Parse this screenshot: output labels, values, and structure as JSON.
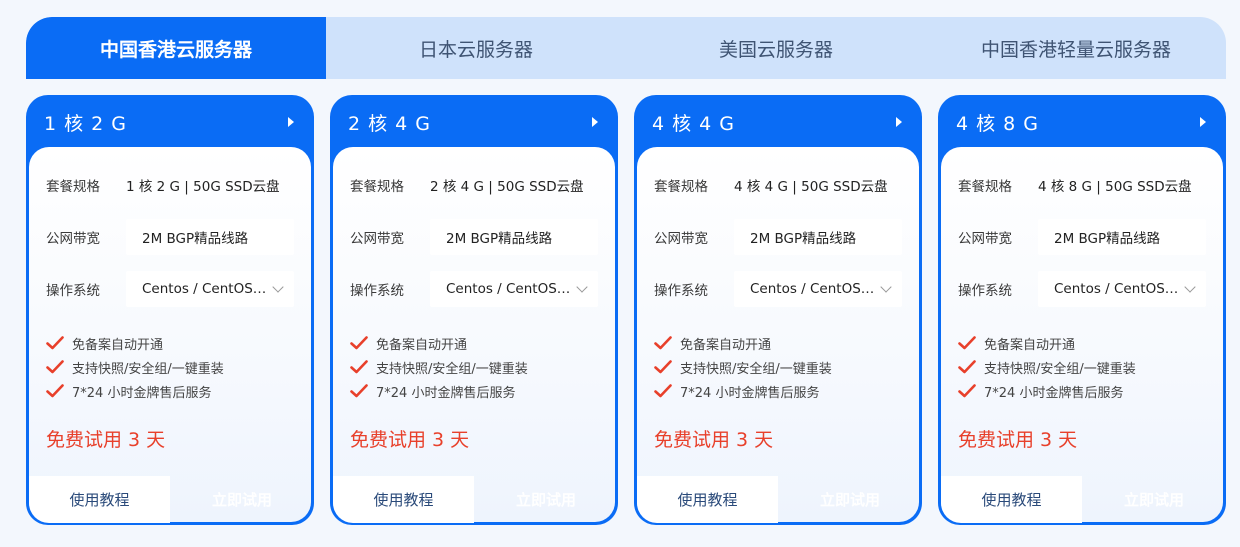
{
  "tabs": [
    {
      "label": "中国香港云服务器",
      "active": true
    },
    {
      "label": "日本云服务器",
      "active": false
    },
    {
      "label": "美国云服务器",
      "active": false
    },
    {
      "label": "中国香港轻量云服务器",
      "active": false
    }
  ],
  "labels": {
    "spec": "套餐规格",
    "bandwidth": "公网带宽",
    "os": "操作系统"
  },
  "cards": [
    {
      "title": "1 核 2 G",
      "spec": "1 核 2 G | 50G SSD云盘",
      "bandwidth": "2M BGP精品线路",
      "os": "Centos / CentOS…",
      "features": [
        "免备案自动开通",
        "支持快照/安全组/一键重装",
        "7*24 小时金牌售后服务"
      ],
      "trial": "免费试用 3 天",
      "tutorial_label": "使用教程",
      "try_label": "立即试用"
    },
    {
      "title": "2 核 4 G",
      "spec": "2 核 4 G | 50G SSD云盘",
      "bandwidth": "2M BGP精品线路",
      "os": "Centos / CentOS…",
      "features": [
        "免备案自动开通",
        "支持快照/安全组/一键重装",
        "7*24 小时金牌售后服务"
      ],
      "trial": "免费试用 3 天",
      "tutorial_label": "使用教程",
      "try_label": "立即试用"
    },
    {
      "title": "4 核 4 G",
      "spec": "4 核 4 G | 50G SSD云盘",
      "bandwidth": "2M BGP精品线路",
      "os": "Centos / CentOS…",
      "features": [
        "免备案自动开通",
        "支持快照/安全组/一键重装",
        "7*24 小时金牌售后服务"
      ],
      "trial": "免费试用 3 天",
      "tutorial_label": "使用教程",
      "try_label": "立即试用"
    },
    {
      "title": "4 核 8 G",
      "spec": "4 核 8 G | 50G SSD云盘",
      "bandwidth": "2M BGP精品线路",
      "os": "Centos / CentOS…",
      "features": [
        "免备案自动开通",
        "支持快照/安全组/一键重装",
        "7*24 小时金牌售后服务"
      ],
      "trial": "免费试用 3 天",
      "tutorial_label": "使用教程",
      "try_label": "立即试用"
    }
  ],
  "colors": {
    "primary": "#0a6cf5",
    "tab_bg": "#cfe2fb",
    "accent_red": "#e8402b"
  },
  "icons": {
    "card_arrow": "arrow-right-icon",
    "os_select": "chevron-down-icon",
    "feature": "check-icon"
  }
}
